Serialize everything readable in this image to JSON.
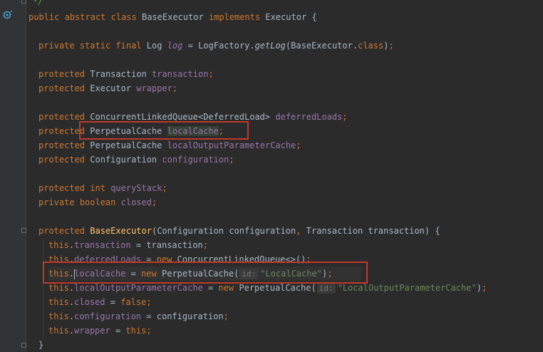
{
  "code": {
    "comment_end": "*/",
    "class_decl": {
      "mod1": "public",
      "mod2": "abstract",
      "kw_class": "class",
      "name": "BaseExecutor",
      "kw_impl": "implements",
      "iface": "Executor",
      "brace": "{"
    },
    "log_line": {
      "m1": "private",
      "m2": "static",
      "m3": "final",
      "type": "Log",
      "name": "log",
      "eq": "=",
      "call_obj": "LogFactory.",
      "call_fn": "getLog",
      "arg": "(BaseExecutor.",
      "arg_kw": "class",
      "arg_end": ")",
      "semi": ";"
    },
    "fields": [
      {
        "mod": "protected",
        "type": "Transaction",
        "name": "transaction"
      },
      {
        "mod": "protected",
        "type": "Executor",
        "name": "wrapper"
      },
      {
        "mod": "protected",
        "type": "ConcurrentLinkedQueue<DeferredLoad>",
        "name": "deferredLoads"
      },
      {
        "mod": "protected",
        "type": "PerpetualCache",
        "name": "localCache"
      },
      {
        "mod": "protected",
        "type": "PerpetualCache",
        "name": "localOutputParameterCache"
      },
      {
        "mod": "protected",
        "type": "Configuration",
        "name": "configuration"
      },
      {
        "mod": "protected",
        "type": "int",
        "name": "queryStack"
      },
      {
        "mod": "private",
        "type": "boolean",
        "name": "closed"
      }
    ],
    "ctor": {
      "mod": "protected",
      "name": "BaseExecutor",
      "params": "(Configuration configuration",
      "comma": ",",
      "params2": " Transaction transaction) {"
    },
    "body": {
      "this": "this",
      "dot": ".",
      "eq": " = ",
      "new": "new",
      "l1_field": "transaction",
      "l1_val": "transaction",
      "l2_field": "deferredLoads",
      "l2_type": "ConcurrentLinkedQueue<>()",
      "l3_field": "localCache",
      "l3_type": "PerpetualCache(",
      "l3_hint": "id:",
      "l3_arg": "\"LocalCache\"",
      "l3_end": ")",
      "l4_field": "localOutputParameterCache",
      "l4_type": "PerpetualCache(",
      "l4_hint": "id:",
      "l4_arg": "\"LocalOutputParameterCache\"",
      "l4_end": ")",
      "l5_field": "closed",
      "l5_val": "false",
      "l6_field": "configuration",
      "l6_val": "configuration",
      "l7_field": "wrapper",
      "l7_val": "this",
      "semi": ";",
      "close": "}"
    }
  },
  "colors": {
    "background": "#2b2b2b",
    "keyword": "#cc7832",
    "field": "#9876aa",
    "string": "#6a8759",
    "annotation_box": "#c0392b"
  }
}
